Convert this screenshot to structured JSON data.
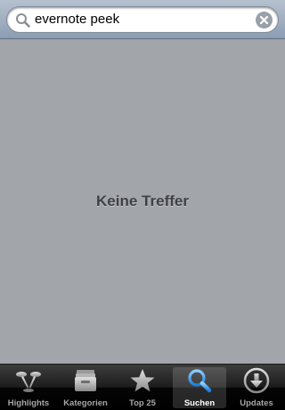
{
  "search": {
    "value": "evernote peek",
    "icon": "search-icon",
    "clear_icon": "clear-icon"
  },
  "content": {
    "empty_message": "Keine Treffer"
  },
  "tabbar": {
    "active_tab": "Suchen",
    "tabs": [
      {
        "label": "Highlights",
        "icon": "highlights-icon"
      },
      {
        "label": "Kategorien",
        "icon": "categories-icon"
      },
      {
        "label": "Top 25",
        "icon": "star-icon"
      },
      {
        "label": "Suchen",
        "icon": "search-icon"
      },
      {
        "label": "Updates",
        "icon": "download-icon"
      }
    ]
  },
  "colors": {
    "background": "#a2a5aa",
    "active_tab_icon": "#4aa8ff",
    "inactive_tab": "#a6a6a6"
  }
}
